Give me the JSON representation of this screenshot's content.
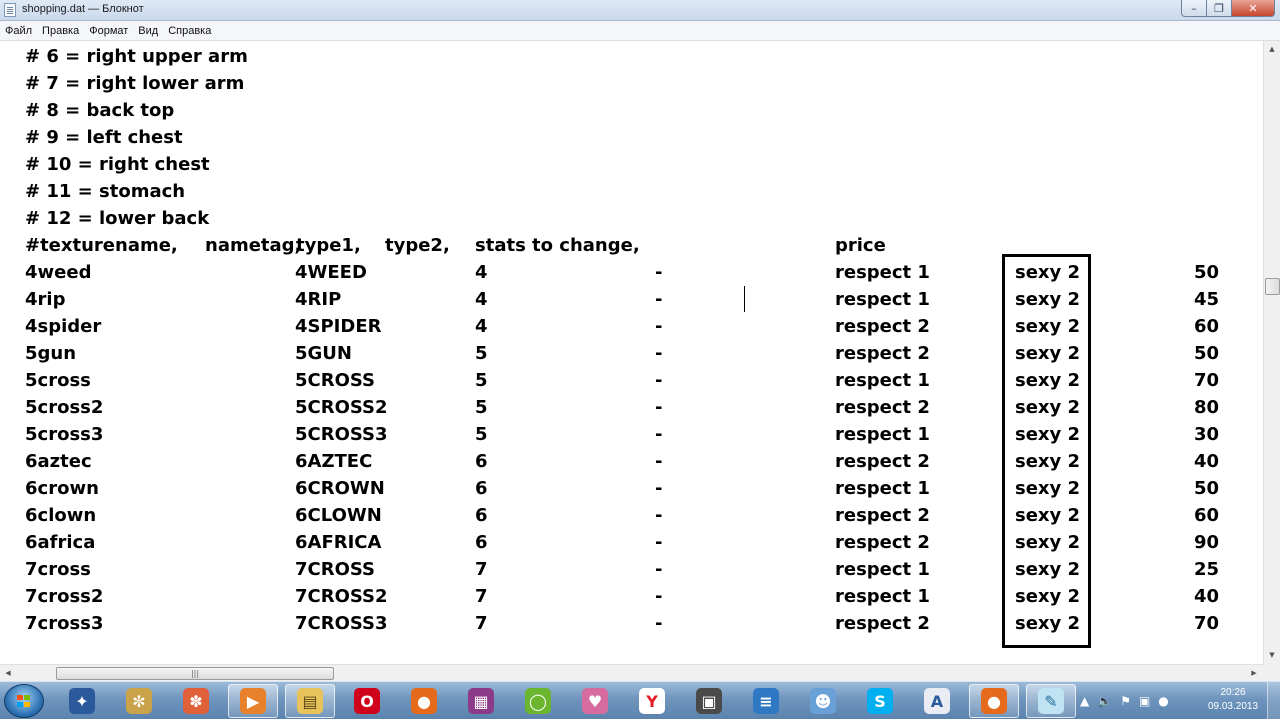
{
  "window": {
    "title": "shopping.dat — Блокнот",
    "menu": [
      "Файл",
      "Правка",
      "Формат",
      "Вид",
      "Справка"
    ]
  },
  "comments": [
    "# 6 = right upper arm",
    "# 7 = right lower arm",
    "# 8 = back top",
    "# 9 = left chest",
    "# 10 = right chest",
    "# 11 = stomach",
    "# 12 = lower back"
  ],
  "header": {
    "texturename": "#texturename,",
    "nametag": "nametag,",
    "type1": "type1,",
    "type2": "type2,",
    "stats": "stats to change,",
    "price": "price"
  },
  "rows": [
    {
      "texturename": "4weed",
      "nametag": "4WEED",
      "type1": "4",
      "type2": "-",
      "stat1": "respect 1",
      "stat2": "sexy 2",
      "price": "50"
    },
    {
      "texturename": "4rip",
      "nametag": "4RIP",
      "type1": "4",
      "type2": "-",
      "stat1": "respect 1",
      "stat2": "sexy 2",
      "price": "45"
    },
    {
      "texturename": "4spider",
      "nametag": "4SPIDER",
      "type1": "4",
      "type2": "-",
      "stat1": "respect 2",
      "stat2": "sexy 2",
      "price": "60"
    },
    {
      "texturename": "5gun",
      "nametag": "5GUN",
      "type1": "5",
      "type2": "-",
      "stat1": "respect 2",
      "stat2": "sexy 2",
      "price": "50"
    },
    {
      "texturename": "5cross",
      "nametag": "5CROSS",
      "type1": "5",
      "type2": "-",
      "stat1": "respect 1",
      "stat2": "sexy 2",
      "price": "70"
    },
    {
      "texturename": "5cross2",
      "nametag": "5CROSS2",
      "type1": "5",
      "type2": "-",
      "stat1": "respect 2",
      "stat2": "sexy 2",
      "price": "80"
    },
    {
      "texturename": "5cross3",
      "nametag": "5CROSS3",
      "type1": "5",
      "type2": "-",
      "stat1": "respect 1",
      "stat2": "sexy 2",
      "price": "30"
    },
    {
      "texturename": "6aztec",
      "nametag": "6AZTEC",
      "type1": "6",
      "type2": "-",
      "stat1": "respect 2",
      "stat2": "sexy 2",
      "price": "40"
    },
    {
      "texturename": "6crown",
      "nametag": "6CROWN",
      "type1": "6",
      "type2": "-",
      "stat1": "respect 1",
      "stat2": "sexy 2",
      "price": "50"
    },
    {
      "texturename": "6clown",
      "nametag": "6CLOWN",
      "type1": "6",
      "type2": "-",
      "stat1": "respect 2",
      "stat2": "sexy 2",
      "price": "60"
    },
    {
      "texturename": "6africa",
      "nametag": "6AFRICA",
      "type1": "6",
      "type2": "-",
      "stat1": "respect 2",
      "stat2": "sexy 2",
      "price": "90"
    },
    {
      "texturename": "7cross",
      "nametag": "7CROSS",
      "type1": "7",
      "type2": "-",
      "stat1": "respect 1",
      "stat2": "sexy 2",
      "price": "25"
    },
    {
      "texturename": "7cross2",
      "nametag": "7CROSS2",
      "type1": "7",
      "type2": "-",
      "stat1": "respect 1",
      "stat2": "sexy 2",
      "price": "40"
    },
    {
      "texturename": "7cross3",
      "nametag": "7CROSS3",
      "type1": "7",
      "type2": "-",
      "stat1": "respect 2",
      "stat2": "sexy 2",
      "price": "70"
    }
  ],
  "taskbar": {
    "apps": [
      "photoshop-icon",
      "paint-icon",
      "pinwheel-icon",
      "media-player-icon",
      "explorer-icon",
      "opera-icon",
      "firefox-icon",
      "winrar-icon",
      "game-icon",
      "anime-icon",
      "yandex-icon",
      "floppy-icon",
      "stack-icon",
      "users-icon",
      "skype-icon",
      "word-icon",
      "firefox-icon",
      "notepad-icon"
    ],
    "time": "20:26",
    "date": "09.03.2013"
  }
}
